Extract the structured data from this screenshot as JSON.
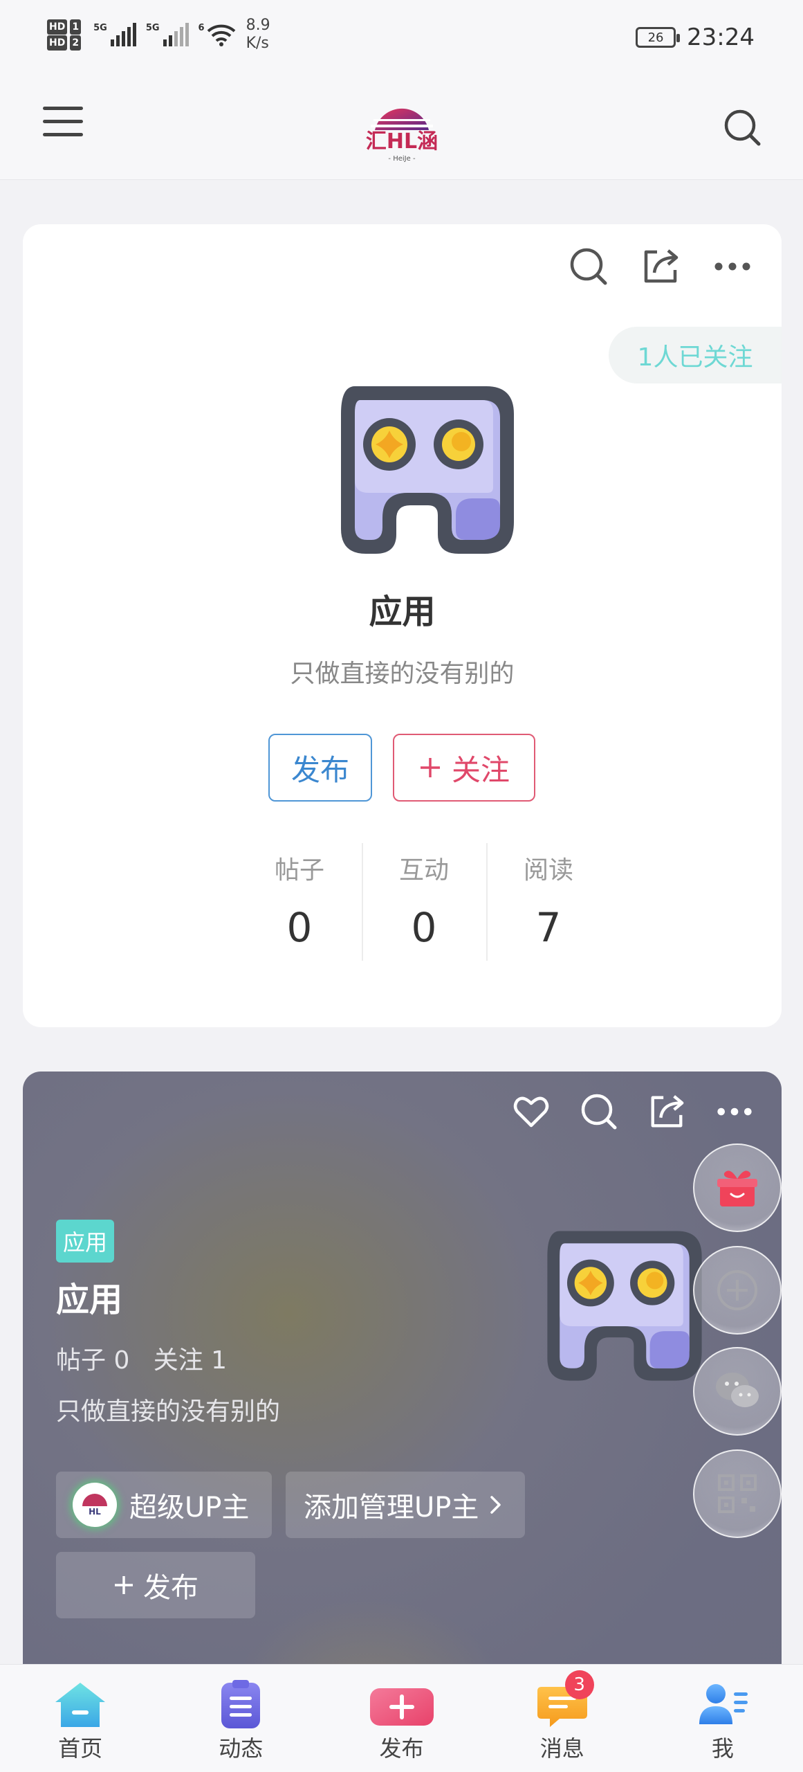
{
  "status_bar": {
    "sim1": "HD",
    "sim1_num": "1",
    "sim2": "HD",
    "sim2_num": "2",
    "net1": "5G",
    "net2": "5G",
    "net3": "6",
    "speed_value": "8.9",
    "speed_unit": "K/s",
    "battery": "26",
    "time": "23:24"
  },
  "header": {
    "menu_icon": "hamburger-menu-icon",
    "logo_text": "汇HL涵",
    "search_icon": "search-icon"
  },
  "board_card": {
    "followers_pill": "1人已关注",
    "title": "应用",
    "description": "只做直接的没有别的",
    "publish_label": "发布",
    "follow_label": "关注",
    "stats": [
      {
        "label": "帖子",
        "value": "0"
      },
      {
        "label": "互动",
        "value": "0"
      },
      {
        "label": "阅读",
        "value": "7"
      }
    ]
  },
  "board_banner": {
    "tag": "应用",
    "title": "应用",
    "posts_label": "帖子 0",
    "follow_label": "关注 1",
    "description": "只做直接的没有别的",
    "super_up_label": "超级UP主",
    "add_admin_label": "添加管理UP主",
    "publish_label": "发布"
  },
  "tabbar": {
    "tabs": [
      {
        "label": "首页",
        "icon": "home-icon"
      },
      {
        "label": "动态",
        "icon": "clipboard-icon"
      },
      {
        "label": "发布",
        "icon": "publish-plus-icon"
      },
      {
        "label": "消息",
        "icon": "message-icon",
        "badge": "3"
      },
      {
        "label": "我",
        "icon": "profile-icon"
      }
    ]
  },
  "colors": {
    "accent_blue": "#3b87cf",
    "accent_red": "#e0486a",
    "accent_teal": "#5cd6ce",
    "badge_red": "#f0435a"
  }
}
